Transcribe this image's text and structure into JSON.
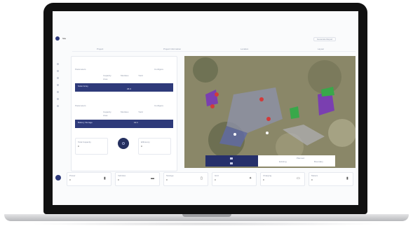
{
  "app": {
    "title": "Site",
    "header_button": "Generate Report"
  },
  "tabs": [
    {
      "label": "Project"
    },
    {
      "label": "Project Information"
    },
    {
      "label": "Location"
    },
    {
      "label": "Layout"
    }
  ],
  "sidebar": {
    "items": [
      "Dashboard",
      "Sites",
      "Layout",
      "Energy",
      "Finance",
      "Reports",
      "Settings"
    ]
  },
  "panel_top": {
    "header_left": "Parameters",
    "header_right": "Configure",
    "row_labels": [
      "Capacity",
      "Modules",
      "Yield",
      "Area"
    ],
    "bar_label": "Solar Array",
    "bar_value": "23.4"
  },
  "panel_bottom": {
    "header_left": "Parameters",
    "header_right": "Configure",
    "row_labels": [
      "Capacity",
      "Modules",
      "Yield",
      "Area"
    ],
    "bar_label": "Battery Storage",
    "bar_value": "12.1"
  },
  "mini_cards": [
    {
      "label": "Total Capacity",
      "value": "0"
    },
    {
      "label": "Efficiency",
      "value": "0"
    }
  ],
  "map": {
    "legend_items": [
      "Existing",
      "Planned",
      "Boundary"
    ],
    "toolbar_icons": [
      "layers-icon",
      "ruler-icon"
    ]
  },
  "stats": [
    {
      "label": "Power",
      "value": "0",
      "icon": "file-icon"
    },
    {
      "label": "Vehicles",
      "value": "0",
      "icon": "car-icon"
    },
    {
      "label": "Storage",
      "value": "0",
      "icon": "battery-icon"
    },
    {
      "label": "Grid",
      "value": "0",
      "icon": "network-icon"
    },
    {
      "label": "Charging",
      "value": "0",
      "icon": "charger-icon"
    },
    {
      "label": "Meters",
      "value": "0",
      "icon": "meter-icon"
    }
  ],
  "colors": {
    "accent": "#2e3a7a",
    "map_purple": "#7a3fb0",
    "map_red": "#d23a3a",
    "map_green": "#39a84a"
  }
}
